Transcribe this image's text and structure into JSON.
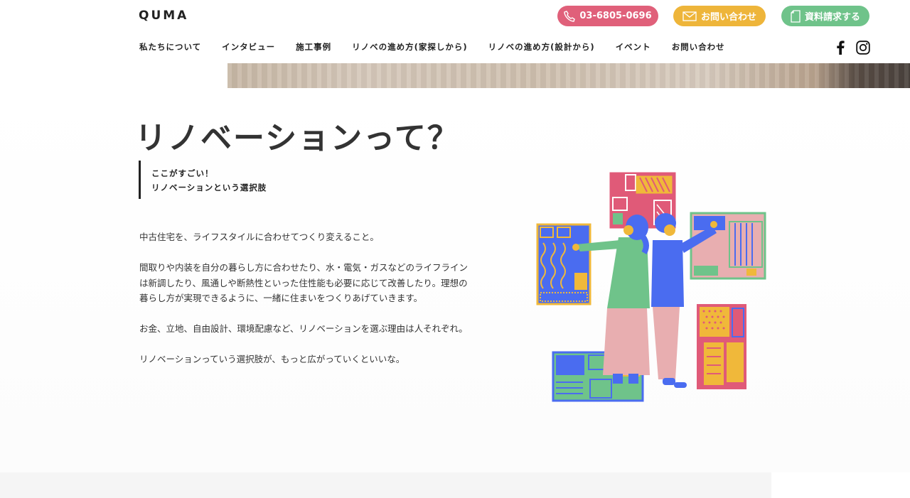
{
  "header": {
    "logo": "QUMA",
    "tel_label": "03-6805-0696",
    "contact_label": "お問い合わせ",
    "request_label": "資料請求する"
  },
  "nav": {
    "items": [
      {
        "label": "私たちについて"
      },
      {
        "label": "インタビュー"
      },
      {
        "label": "施工事例"
      },
      {
        "label": "リノベの進め方(家探しから)"
      },
      {
        "label": "リノベの進め方(設計から)"
      },
      {
        "label": "イベント"
      },
      {
        "label": "お問い合わせ"
      }
    ],
    "social": [
      "facebook-icon",
      "instagram-icon"
    ]
  },
  "main": {
    "title": "リノベーションって？",
    "subtitle_line1": "ここがすごい！",
    "subtitle_line2": "リノベーションという選択肢",
    "paragraphs": [
      "中古住宅を、ライフスタイルに合わせてつくり変えること。",
      "間取りや内装を自分の暮らし方に合わせたり、水・電気・ガスなどのライフラインは新調したり、風通しや断熱性といった住性能も必要に応じて改善したり。理想の暮らし方が実現できるように、一緒に住まいをつくりあげていきます。",
      "お金、立地、自由設計、環境配慮など、リノベーションを選ぶ理由は人それぞれ。",
      "リノベーションっていう選択肢が、もっと広がっていくといいな。"
    ]
  },
  "colors": {
    "tel": "#e0607a",
    "mail": "#eeb53a",
    "doc": "#6fc38a",
    "illust_blue": "#4a6cf0",
    "illust_pink": "#e05a78",
    "illust_green": "#6fc38a",
    "illust_yellow": "#f0b83a",
    "illust_skin": "#e8aeb0"
  }
}
